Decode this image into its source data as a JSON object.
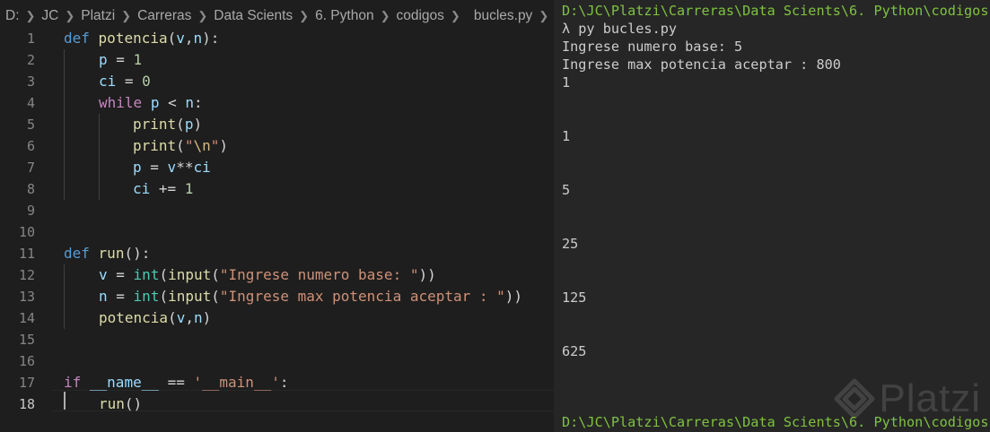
{
  "breadcrumb": {
    "items": [
      "D:",
      "JC",
      "Platzi",
      "Carreras",
      "Data Scients",
      "6. Python",
      "codigos",
      "bucles.py",
      "..."
    ],
    "file_icon": "python-file-icon"
  },
  "editor": {
    "line_numbers": [
      "1",
      "2",
      "3",
      "4",
      "5",
      "6",
      "7",
      "8",
      "9",
      "10",
      "11",
      "12",
      "13",
      "14",
      "15",
      "16",
      "17",
      "18"
    ],
    "active_line": "18",
    "code": {
      "l1": [
        "def",
        " ",
        "potencia",
        "(",
        "v",
        ",",
        "n",
        "):"
      ],
      "l2": [
        "p",
        " = ",
        "1"
      ],
      "l3": [
        "ci",
        " = ",
        "0"
      ],
      "l4": [
        "while",
        " ",
        "p",
        " < ",
        "n",
        ":"
      ],
      "l5": [
        "print",
        "(",
        "p",
        ")"
      ],
      "l6": [
        "print",
        "(",
        "\"",
        "\\n",
        "\"",
        ")"
      ],
      "l7": [
        "p",
        " = ",
        "v",
        "**",
        "ci"
      ],
      "l8": [
        "ci",
        " += ",
        "1"
      ],
      "l11": [
        "def",
        " ",
        "run",
        "():"
      ],
      "l12": [
        "v",
        " = ",
        "int",
        "(",
        "input",
        "(",
        "\"Ingrese numero base: \"",
        "))"
      ],
      "l13": [
        "n",
        " = ",
        "int",
        "(",
        "input",
        "(",
        "\"Ingrese max potencia aceptar : \"",
        "))"
      ],
      "l14": [
        "potencia",
        "(",
        "v",
        ",",
        "n",
        ")"
      ],
      "l17": [
        "if",
        " ",
        "__name__",
        " == ",
        "'__main__'",
        ":"
      ],
      "l18": [
        "run",
        "()"
      ]
    }
  },
  "terminal": {
    "cwd_top": "D:\\JC\\Platzi\\Carreras\\Data Scients\\6. Python\\codigos",
    "command": "λ py bucles.py",
    "prompt_base": "Ingrese numero base: 5",
    "prompt_max": "Ingrese max potencia aceptar : 800",
    "outputs": [
      "1",
      "1",
      "5",
      "25",
      "125",
      "625"
    ],
    "cwd_bottom": "D:\\JC\\Platzi\\Carreras\\Data Scients\\6. Python\\codigos"
  },
  "watermark": {
    "text": "Platzi"
  },
  "colors": {
    "editor_bg": "#1e1e1e",
    "terminal_bg": "#262626",
    "keyword": "#569cd6",
    "control": "#c586c0",
    "function": "#dcdcaa",
    "variable": "#9cdcfe",
    "number": "#b5cea8",
    "string": "#ce9178",
    "terminal_path": "#7fc241"
  }
}
